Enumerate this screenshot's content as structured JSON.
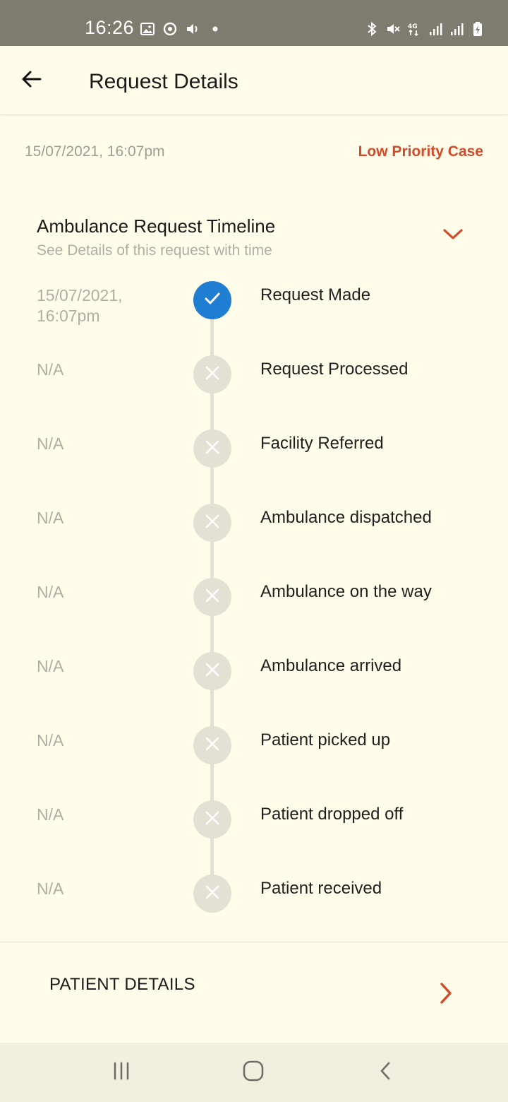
{
  "status_bar": {
    "time": "16:26",
    "left_icons": [
      "image-icon",
      "sync-icon",
      "volume-icon",
      "dot-icon"
    ],
    "right_icons": [
      "bluetooth-icon",
      "mute-icon",
      "4g-icon",
      "signal-icon",
      "signal-icon",
      "battery-charging-icon"
    ]
  },
  "app_bar": {
    "back_icon": "arrow-left-icon",
    "title": "Request Details"
  },
  "request": {
    "date": "15/07/2021, 16:07pm",
    "priority": "Low Priority Case"
  },
  "timeline": {
    "title": "Ambulance Request Timeline",
    "subtitle": "See Details of this request with time",
    "toggle_icon": "chevron-down-icon",
    "steps": [
      {
        "time": "15/07/2021,\n16:07pm",
        "label": "Request Made",
        "status": "done"
      },
      {
        "time": "N/A",
        "label": "Request Processed",
        "status": "pending"
      },
      {
        "time": "N/A",
        "label": "Facility Referred",
        "status": "pending"
      },
      {
        "time": "N/A",
        "label": "Ambulance dispatched",
        "status": "pending"
      },
      {
        "time": "N/A",
        "label": "Ambulance on the way",
        "status": "pending"
      },
      {
        "time": "N/A",
        "label": "Ambulance arrived",
        "status": "pending"
      },
      {
        "time": "N/A",
        "label": "Patient picked up",
        "status": "pending"
      },
      {
        "time": "N/A",
        "label": "Patient dropped off",
        "status": "pending"
      },
      {
        "time": "N/A",
        "label": "Patient received",
        "status": "pending"
      }
    ]
  },
  "patient_details": {
    "label": "PATIENT DETAILS",
    "icon": "chevron-right-icon"
  },
  "nav_bar": {
    "buttons": [
      "recents-icon",
      "home-icon",
      "back-icon"
    ]
  },
  "colors": {
    "background": "#fffde9",
    "accent_red": "#d24a2a",
    "done_blue": "#1f7ed2",
    "pending_gray": "#e3e1d3",
    "status_bar": "#7d7c6e"
  }
}
